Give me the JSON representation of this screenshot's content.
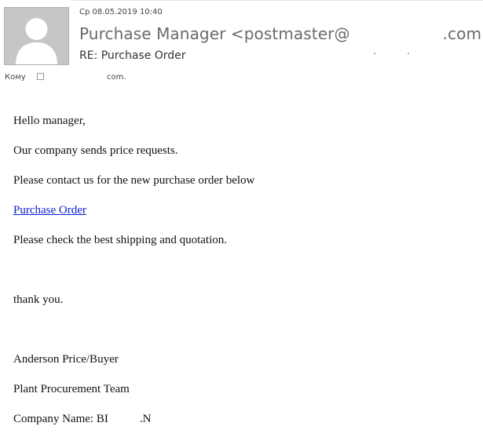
{
  "header": {
    "date": "Ср 08.05.2019 10:40",
    "sender_name_prefix": "Purchase Manager <postmaster@",
    "sender_suffix": ".com>",
    "subject": "RE: Purchase Order",
    "to_label": "Кому",
    "to_domain": "com."
  },
  "icons": {
    "avatar": "default-person-avatar",
    "recipient": "checkbox"
  },
  "body": {
    "greeting": "Hello manager,",
    "line1": "Our company sends price requests.",
    "line2": "Please contact us for the new purchase order below",
    "link_label": "Purchase Order",
    "line3": "Please check the best shipping and quotation.",
    "thanks": "thank you.",
    "sig_name": "Anderson Price/Buyer",
    "sig_team": "Plant Procurement Team",
    "sig_company_prefix": "Company Name: BI",
    "sig_company_suffix": ".N"
  },
  "colors": {
    "link": "#0b1fcc",
    "avatar_bg": "#c6c6c6",
    "sender_text": "#6a6a6a"
  }
}
